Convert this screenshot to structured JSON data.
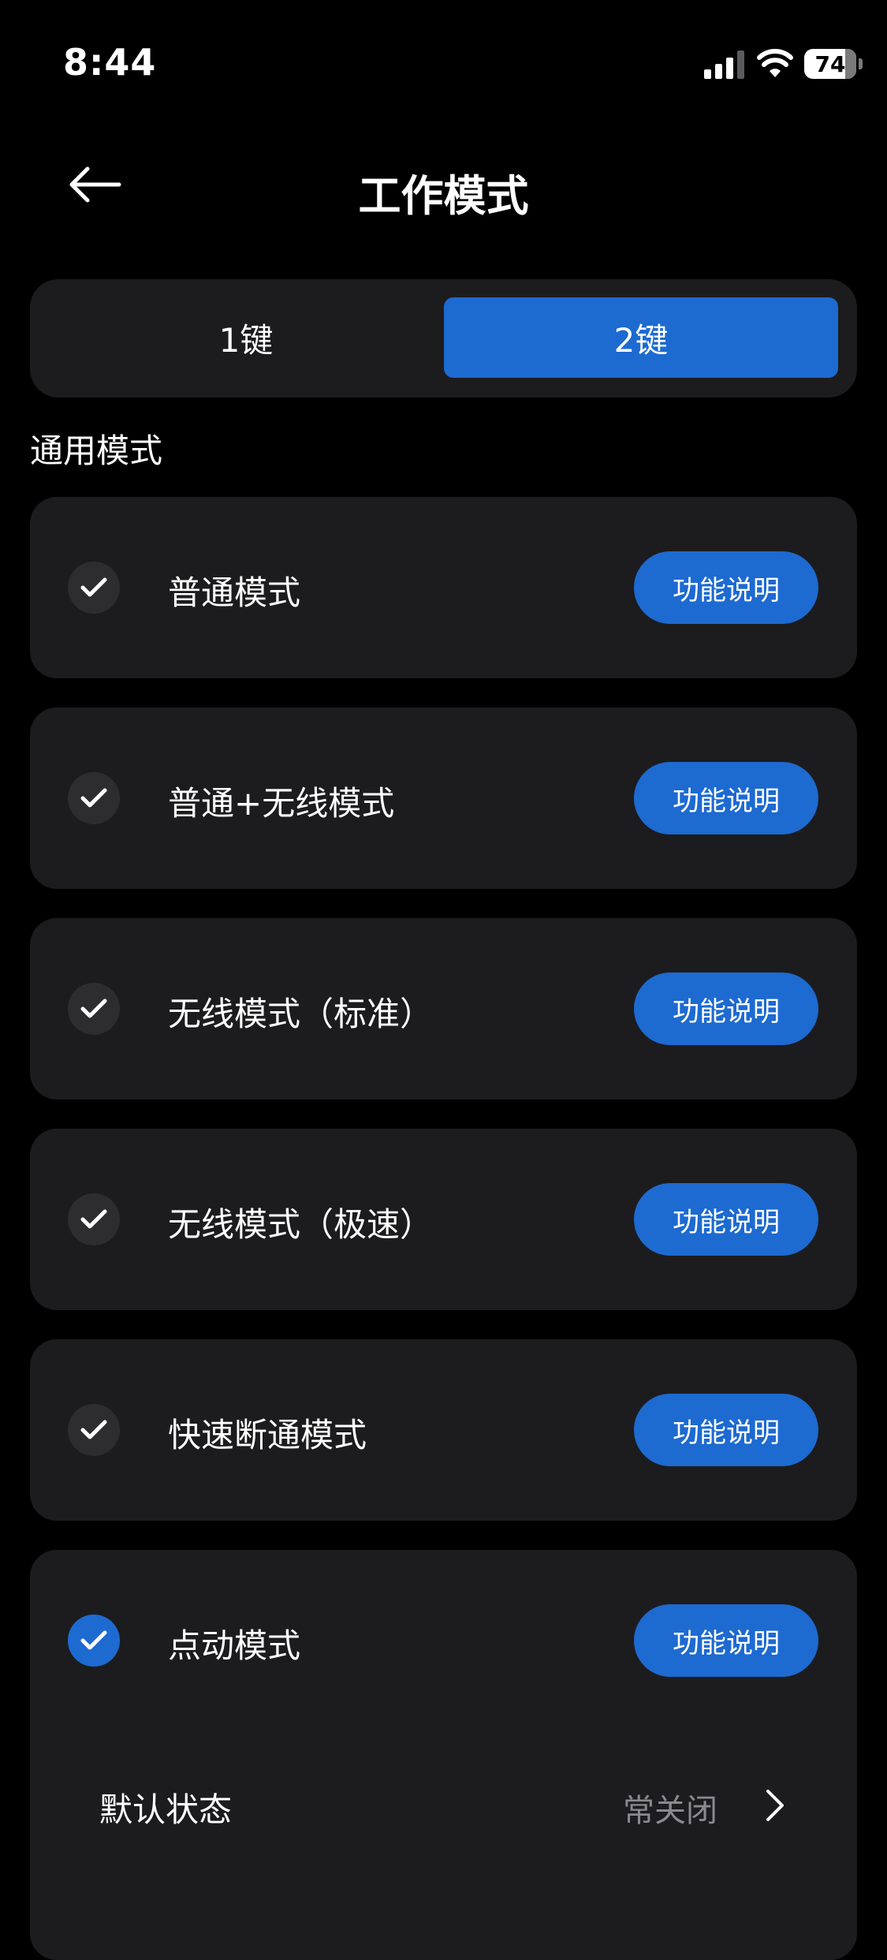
{
  "status_bar": {
    "time": "8:44",
    "battery": "74",
    "icons": [
      "signal-icon",
      "wifi-icon",
      "battery-icon"
    ]
  },
  "header": {
    "title": "工作模式",
    "back_icon": "arrow-left-icon"
  },
  "tabs": {
    "items": [
      {
        "label": "1键",
        "active": false
      },
      {
        "label": "2键",
        "active": true
      }
    ]
  },
  "section": {
    "label": "通用模式"
  },
  "modes": [
    {
      "label": "普通模式",
      "button": "功能说明",
      "selected": false
    },
    {
      "label": "普通+无线模式",
      "button": "功能说明",
      "selected": false
    },
    {
      "label": "无线模式（标准）",
      "button": "功能说明",
      "selected": false
    },
    {
      "label": "无线模式（极速）",
      "button": "功能说明",
      "selected": false
    },
    {
      "label": "快速断通模式",
      "button": "功能说明",
      "selected": false
    },
    {
      "label": "点动模式",
      "button": "功能说明",
      "selected": true
    }
  ],
  "default_state": {
    "label": "默认状态",
    "value": "常关闭"
  },
  "colors": {
    "accent": "#1d6ad1",
    "card": "#1c1c1e",
    "background": "#000000",
    "muted_text": "#8a8a8e"
  }
}
